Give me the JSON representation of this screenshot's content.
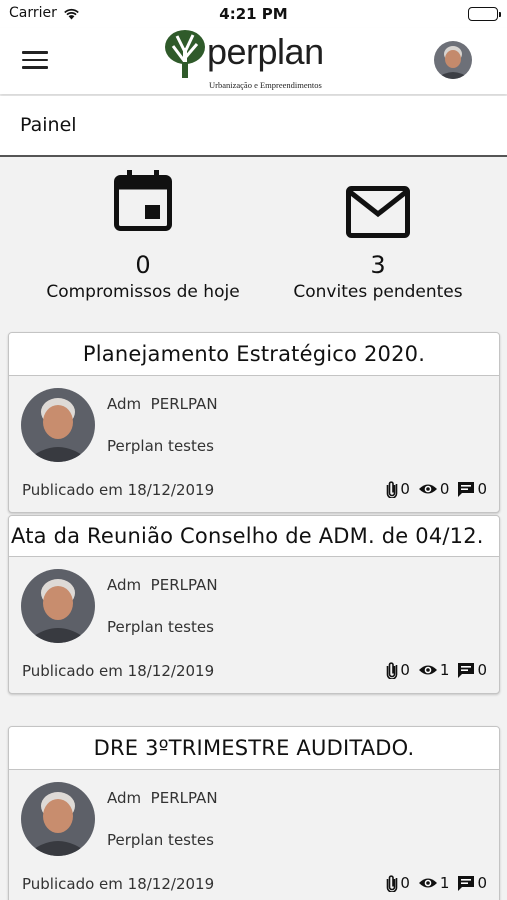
{
  "status_bar": {
    "carrier": "Carrier",
    "time": "4:21 PM"
  },
  "header": {
    "brand": "perplan",
    "tagline": "Urbanização e Empreendimentos"
  },
  "page": {
    "title": "Painel"
  },
  "stats": [
    {
      "icon": "calendar-icon",
      "value": "0",
      "label": "Compromissos de hoje"
    },
    {
      "icon": "envelope-icon",
      "value": "3",
      "label": "Convites pendentes"
    }
  ],
  "posts": [
    {
      "title": "Planejamento Estratégico 2020.",
      "author": "Adm  PERLPAN",
      "org": "Perplan testes",
      "published": "Publicado em 18/12/2019",
      "attachments": "0",
      "views": "0",
      "comments": "0"
    },
    {
      "title": "Ata da Reunião Conselho de ADM. de 04/12.",
      "author": "Adm  PERLPAN",
      "org": "Perplan testes",
      "published": "Publicado em 18/12/2019",
      "attachments": "0",
      "views": "1",
      "comments": "0"
    },
    {
      "title": "DRE 3ºTRIMESTRE AUDITADO.",
      "author": "Adm  PERLPAN",
      "org": "Perplan testes",
      "published": "Publicado em 18/12/2019",
      "attachments": "0",
      "views": "1",
      "comments": "0"
    }
  ],
  "colors": {
    "brand_green": "#2f5a2a",
    "text": "#111111",
    "background": "#f2f2f2"
  }
}
